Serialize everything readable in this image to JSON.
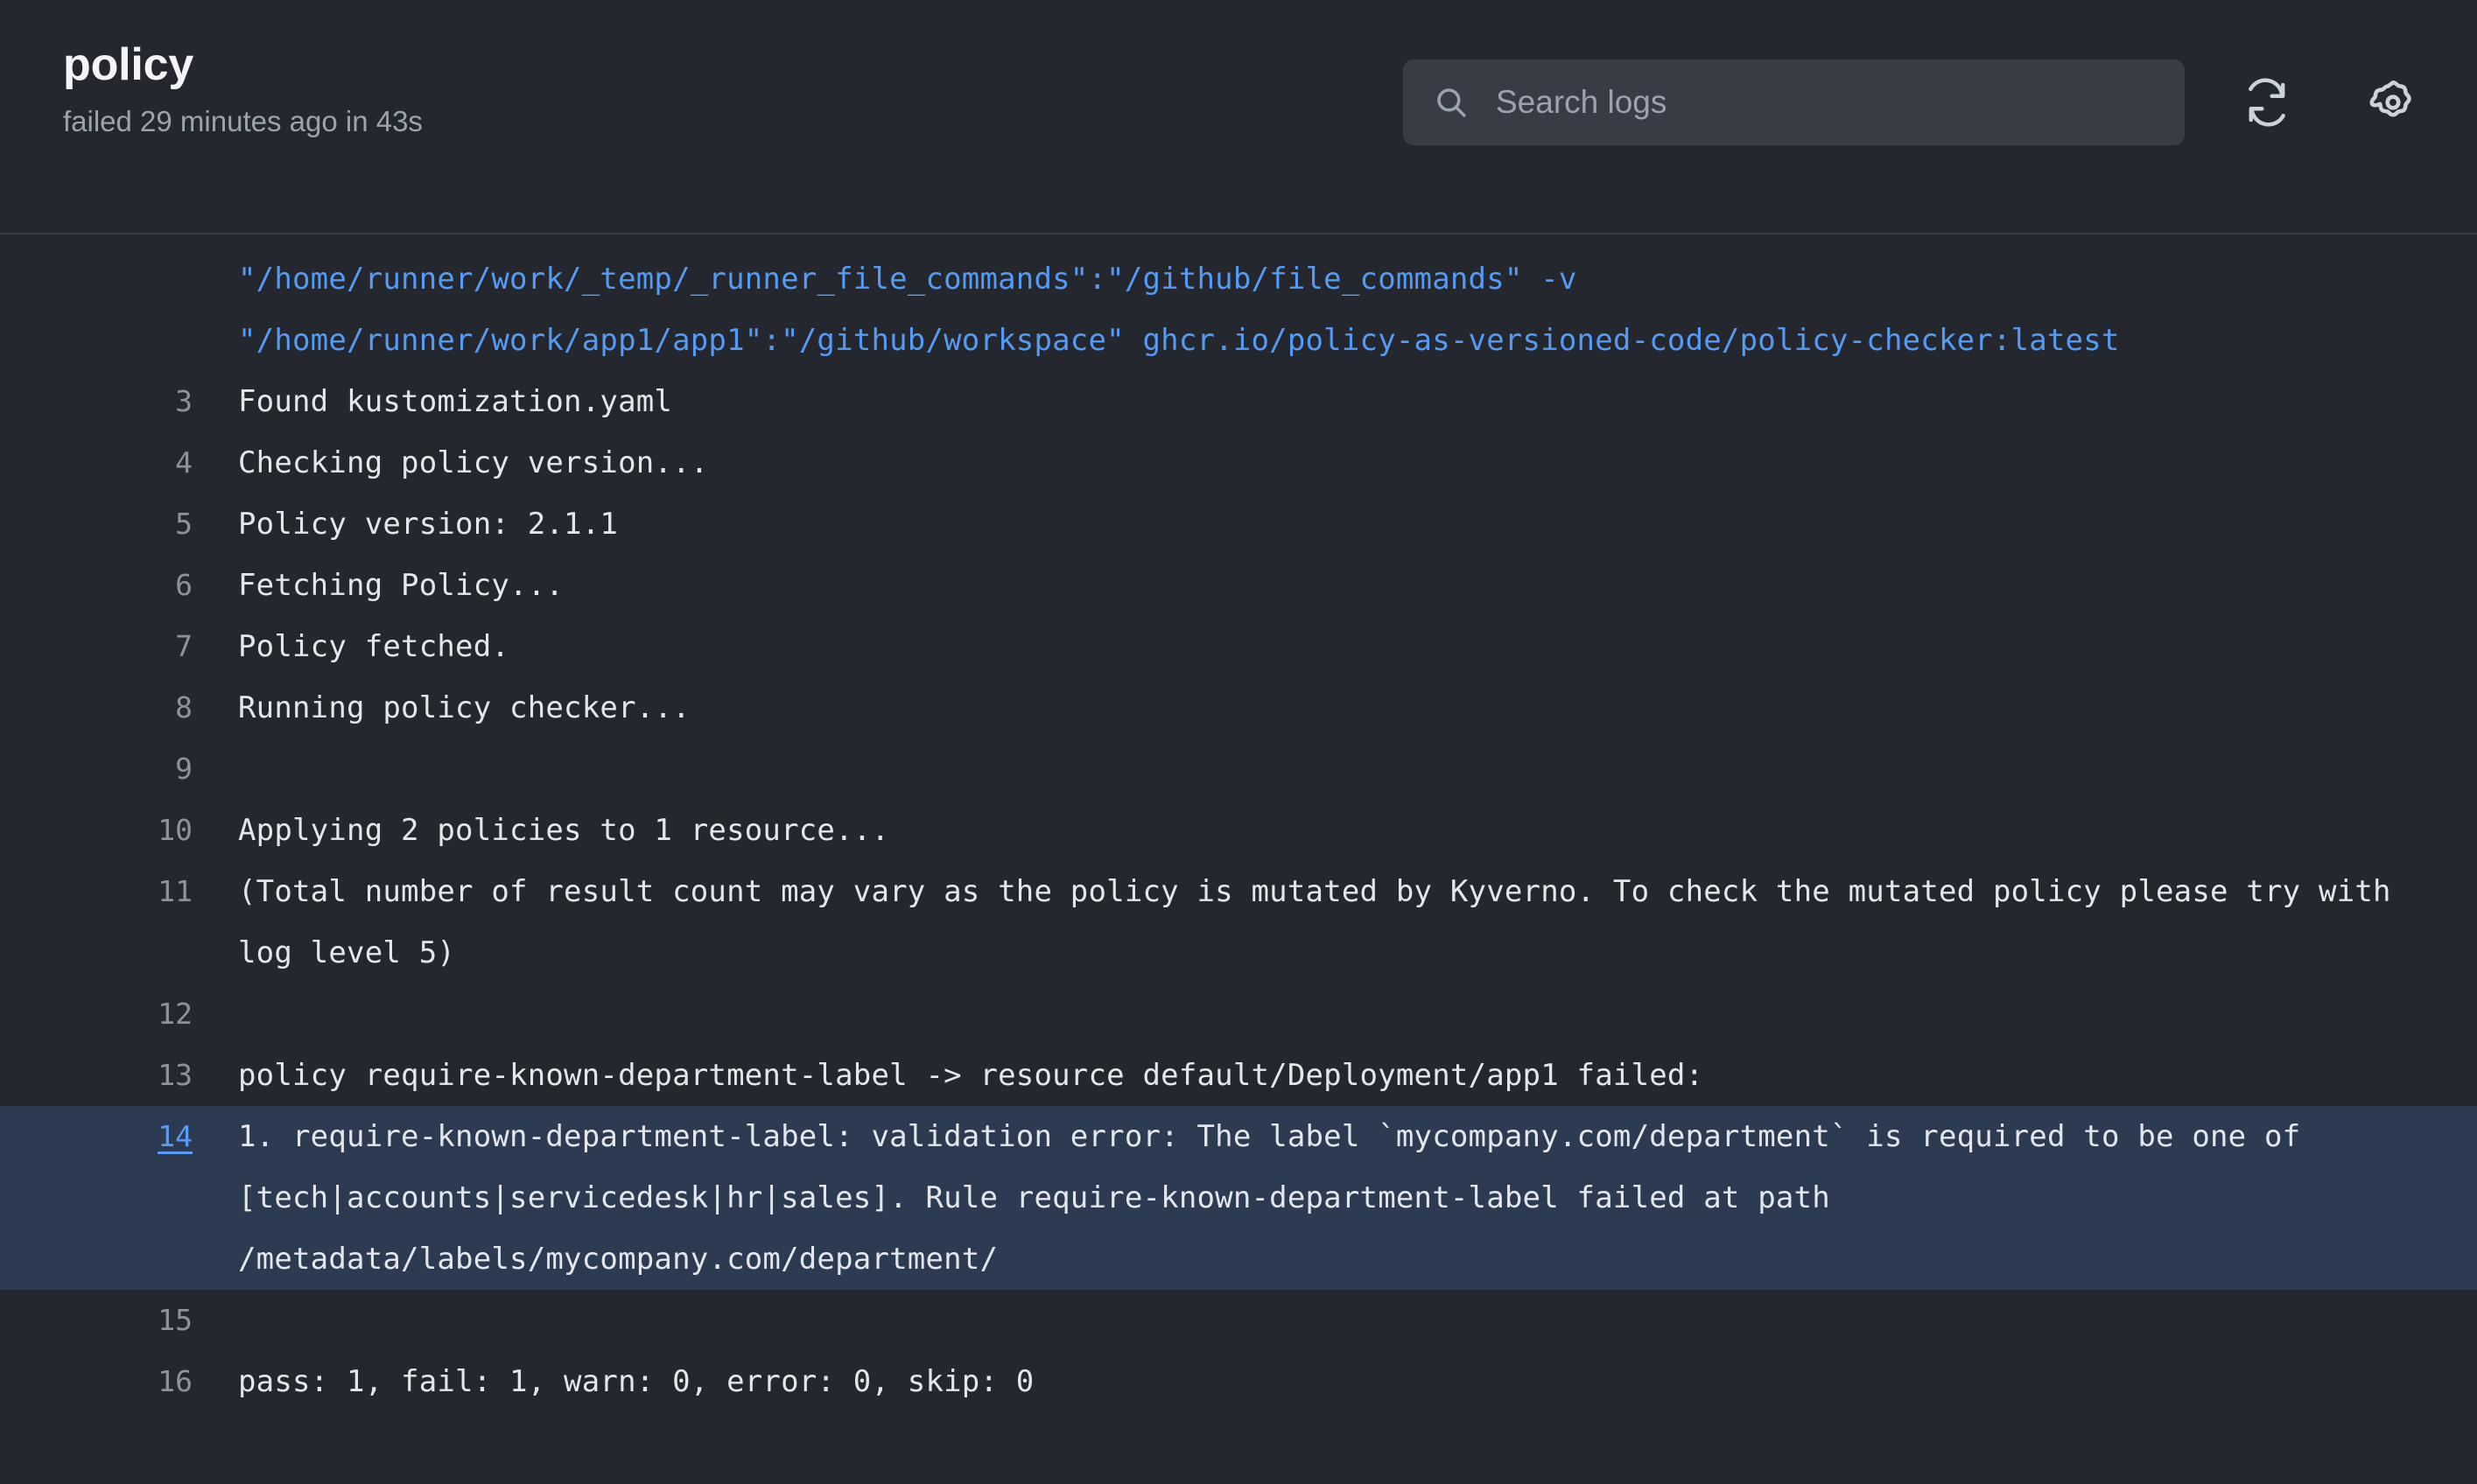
{
  "header": {
    "job_title": "policy",
    "job_status": "failed 29 minutes ago in 43s",
    "search": {
      "placeholder": "Search logs",
      "value": ""
    },
    "refresh_icon": "refresh-icon",
    "settings_icon": "gear-icon",
    "search_icon": "search-icon"
  },
  "colors": {
    "header_bg": "#24272d",
    "log_bg": "#24272d",
    "divider": "#383c45",
    "search_bg": "#383c45",
    "highlight_bg": "#2c3b52",
    "link_blue": "#539bf5",
    "line_number": "#8b939d",
    "text": "#e3e6eb",
    "muted_text": "#9ba3ad"
  },
  "log": {
    "lines": [
      {
        "number": "",
        "text": "\"/home/runner/work/_temp/_runner_file_commands\":\"/github/file_commands\" -v",
        "color": "blue",
        "highlight": false
      },
      {
        "number": "",
        "text": "\"/home/runner/work/app1/app1\":\"/github/workspace\" ghcr.io/policy-as-versioned-code/policy-checker:latest",
        "color": "blue",
        "highlight": false
      },
      {
        "number": "3",
        "text": "Found kustomization.yaml",
        "color": "default",
        "highlight": false
      },
      {
        "number": "4",
        "text": "Checking policy version...",
        "color": "default",
        "highlight": false
      },
      {
        "number": "5",
        "text": "Policy version: 2.1.1",
        "color": "default",
        "highlight": false
      },
      {
        "number": "6",
        "text": "Fetching Policy...",
        "color": "default",
        "highlight": false
      },
      {
        "number": "7",
        "text": "Policy fetched.",
        "color": "default",
        "highlight": false
      },
      {
        "number": "8",
        "text": "Running policy checker...",
        "color": "default",
        "highlight": false
      },
      {
        "number": "9",
        "text": "",
        "color": "default",
        "highlight": false
      },
      {
        "number": "10",
        "text": "Applying 2 policies to 1 resource...",
        "color": "default",
        "highlight": false
      },
      {
        "number": "11",
        "text": "(Total number of result count may vary as the policy is mutated by Kyverno. To check the mutated policy please try with log level 5)",
        "color": "default",
        "highlight": false
      },
      {
        "number": "12",
        "text": "",
        "color": "default",
        "highlight": false
      },
      {
        "number": "13",
        "text": "policy require-known-department-label -> resource default/Deployment/app1 failed:",
        "color": "default",
        "highlight": false
      },
      {
        "number": "14",
        "text": "1. require-known-department-label: validation error: The label `mycompany.com/department` is required to be one of [tech|accounts|servicedesk|hr|sales]. Rule require-known-department-label failed at path /metadata/labels/mycompany.com/department/",
        "color": "default",
        "highlight": true
      },
      {
        "number": "15",
        "text": "",
        "color": "default",
        "highlight": false
      },
      {
        "number": "16",
        "text": "pass: 1, fail: 1, warn: 0, error: 0, skip: 0",
        "color": "default",
        "highlight": false
      }
    ]
  }
}
